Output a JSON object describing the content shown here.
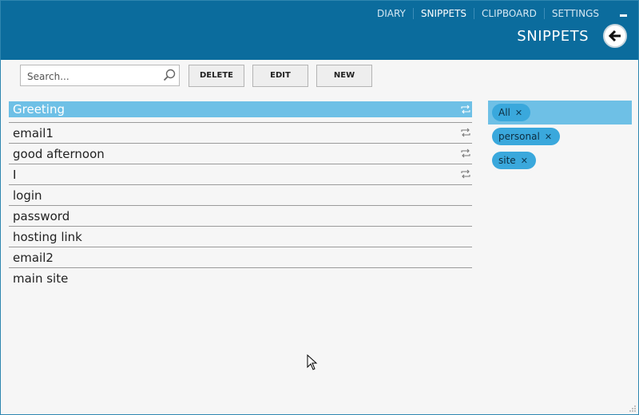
{
  "nav": {
    "items": [
      "DIARY",
      "SNIPPETS",
      "CLIPBOARD",
      "SETTINGS"
    ]
  },
  "header": {
    "title": "SNIPPETS"
  },
  "toolbar": {
    "search_placeholder": "Search...",
    "delete_label": "DELETE",
    "edit_label": "EDIT",
    "new_label": "NEW"
  },
  "snippets": [
    {
      "label": "Greeting",
      "synced": true
    },
    {
      "label": "email1",
      "synced": true
    },
    {
      "label": "good afternoon",
      "synced": true
    },
    {
      "label": "I",
      "synced": true
    },
    {
      "label": "login",
      "synced": false
    },
    {
      "label": "password",
      "synced": false
    },
    {
      "label": "hosting link",
      "synced": false
    },
    {
      "label": "email2",
      "synced": false
    },
    {
      "label": "main site",
      "synced": false
    }
  ],
  "tags": [
    "All",
    "personal",
    "site"
  ],
  "colors": {
    "header": "#0b6c9d",
    "accent": "#6ec0e6",
    "tag": "#3aa8dc"
  }
}
